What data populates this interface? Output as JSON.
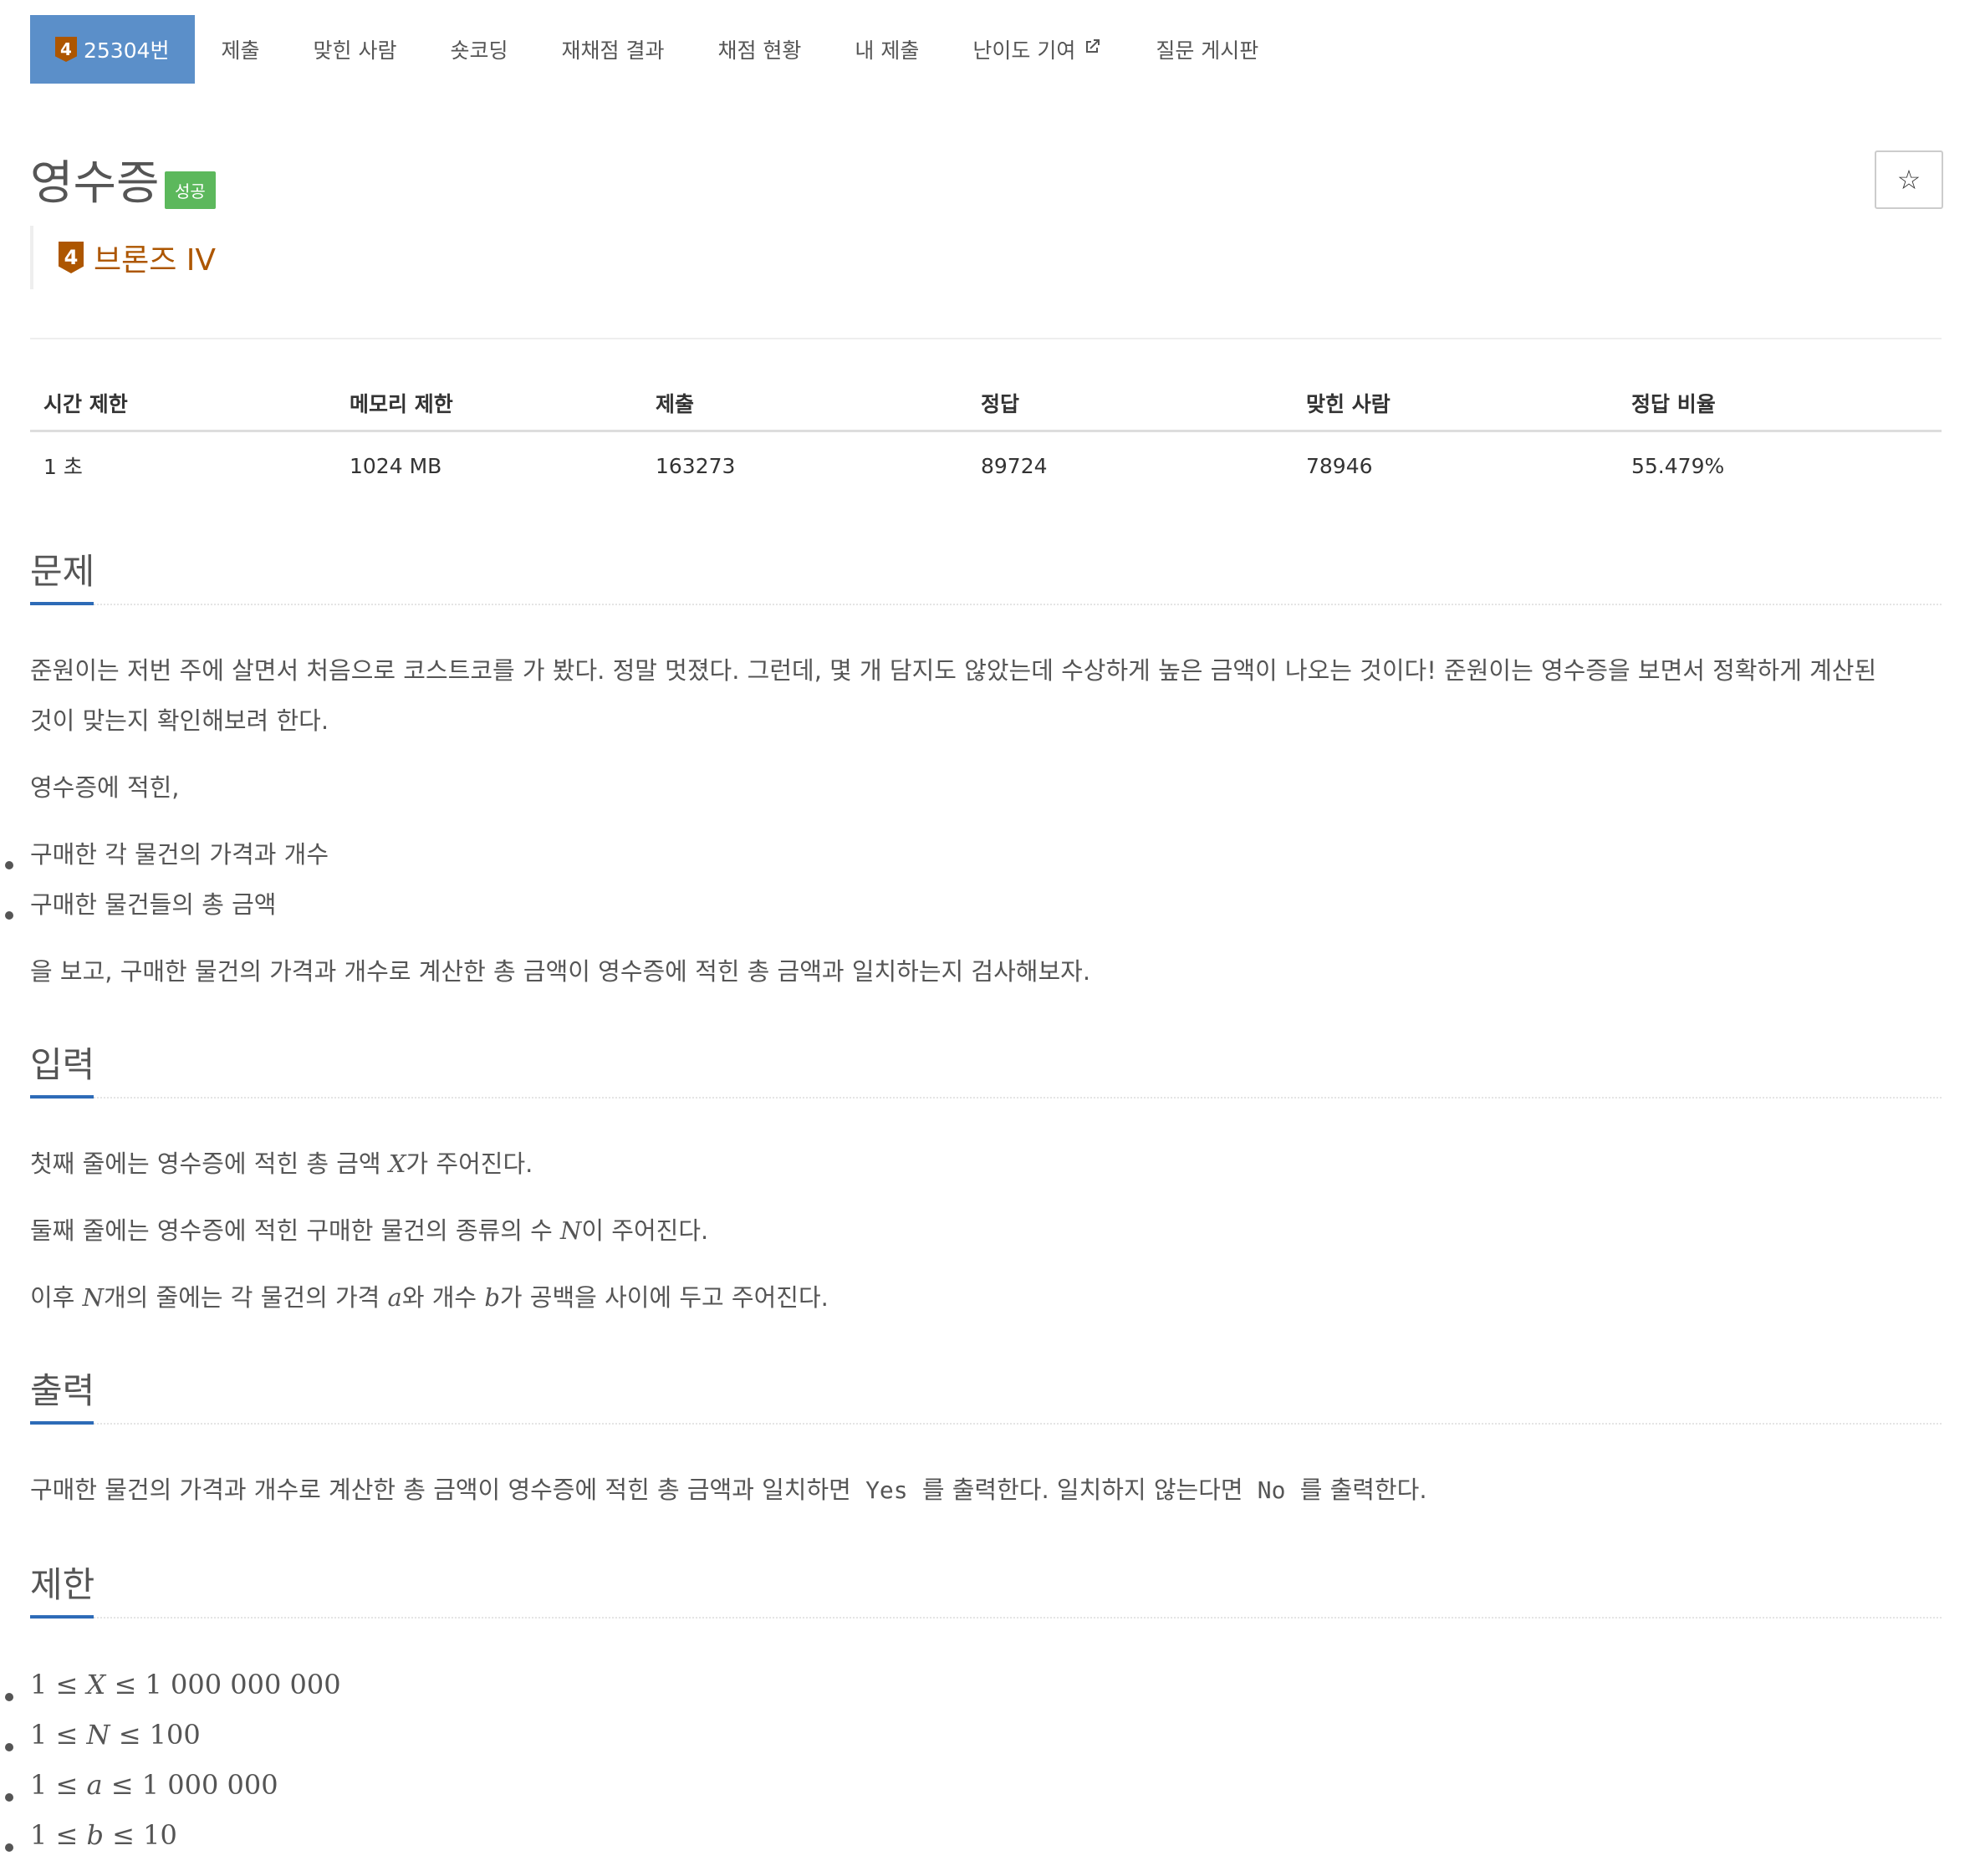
{
  "nav": {
    "problem_tier": "4",
    "problem_id": "25304번",
    "items": [
      "제출",
      "맞힌 사람",
      "숏코딩",
      "재채점 결과",
      "채점 현황",
      "내 제출",
      "난이도 기여",
      "질문 게시판"
    ]
  },
  "problem": {
    "title": "영수증",
    "status_badge": "성공",
    "tier_badge": "4",
    "tier_text": "브론즈 IV",
    "star_icon": "star-icon"
  },
  "info_table": {
    "headers": [
      "시간 제한",
      "메모리 제한",
      "제출",
      "정답",
      "맞힌 사람",
      "정답 비율"
    ],
    "values": [
      "1 초",
      "1024 MB",
      "163273",
      "89724",
      "78946",
      "55.479%"
    ]
  },
  "sections": {
    "problem": {
      "title": "문제",
      "p1_line1": "준원이는 저번 주에 살면서 처음으로 코스트코를 가 봤다. 정말 멋졌다. 그런데, 몇 개 담지도 않았는데 수상하게 높은 금액이 나오는 것이다! 준원이는 영수증을 보면서 정확하게 계산된",
      "p1_line2": "것이 맞는지 확인해보려 한다.",
      "p2": "영수증에 적힌,",
      "list": [
        "구매한 각 물건의 가격과 개수",
        "구매한 물건들의 총 금액"
      ],
      "p3": "을 보고, 구매한 물건의 가격과 개수로 계산한 총 금액이 영수증에 적힌 총 금액과 일치하는지 검사해보자."
    },
    "input": {
      "title": "입력",
      "l1_pre": "첫째 줄에는 영수증에 적힌 총 금액 ",
      "l1_var": "X",
      "l1_post": "가 주어진다.",
      "l2_pre": "둘째 줄에는 영수증에 적힌 구매한 물건의 종류의 수 ",
      "l2_var": "N",
      "l2_post": "이 주어진다.",
      "l3_pre": "이후 ",
      "l3_var1": "N",
      "l3_mid1": "개의 줄에는 각 물건의 가격 ",
      "l3_var2": "a",
      "l3_mid2": "와 개수 ",
      "l3_var3": "b",
      "l3_post": "가 공백을 사이에 두고 주어진다."
    },
    "output": {
      "title": "출력",
      "pre": "구매한 물건의 가격과 개수로 계산한 총 금액이 영수증에 적힌 총 금액과 일치하면 ",
      "yes": "Yes",
      "mid": " 를 출력한다. 일치하지 않는다면 ",
      "no": "No",
      "post": " 를 출력한다."
    },
    "limits": {
      "title": "제한",
      "items": [
        {
          "lo": "1",
          "var": "X",
          "hi": "1 000 000 000"
        },
        {
          "lo": "1",
          "var": "N",
          "hi": "100"
        },
        {
          "lo": "1",
          "var": "a",
          "hi": "1 000 000"
        },
        {
          "lo": "1",
          "var": "b",
          "hi": "10"
        }
      ],
      "leq": "≤"
    }
  }
}
